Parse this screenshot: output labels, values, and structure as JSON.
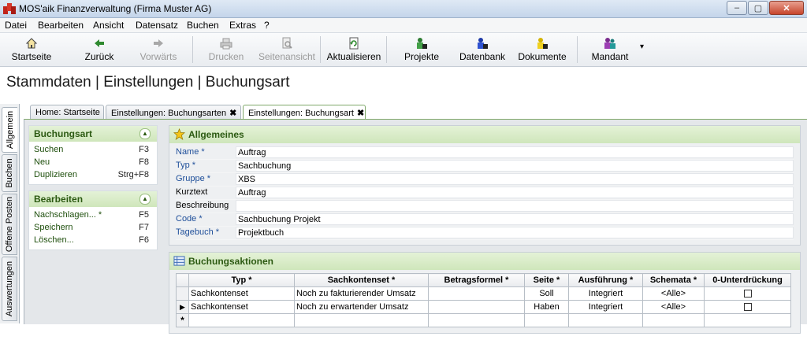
{
  "window": {
    "title": "MOS'aik Finanzverwaltung (Firma Muster AG)",
    "minimize": "–",
    "maximize": "▢",
    "close": "✕"
  },
  "menu": [
    "Datei",
    "Bearbeiten",
    "Ansicht",
    "Datensatz",
    "Buchen",
    "Extras",
    "?"
  ],
  "toolbar": {
    "home": "Startseite",
    "back": "Zurück",
    "forward": "Vorwärts",
    "print": "Drucken",
    "preview": "Seitenansicht",
    "refresh": "Aktualisieren",
    "projects": "Projekte",
    "database": "Datenbank",
    "documents": "Dokumente",
    "client": "Mandant",
    "more": "▾"
  },
  "page_title": "Stammdaten | Einstellungen | Buchungsart",
  "side_tabs": [
    "Allgemein",
    "Buchen",
    "Offene Posten",
    "Auswertungen"
  ],
  "doc_tabs": [
    {
      "label": "Home: Startseite",
      "close": ""
    },
    {
      "label": "Einstellungen: Buchungsarten",
      "close": "✖"
    },
    {
      "label": "Einstellungen: Buchungsart",
      "close": "✖"
    }
  ],
  "nav": {
    "buchungsart": {
      "title": "Buchungsart",
      "collapse": "▲",
      "items": [
        {
          "label": "Suchen",
          "key": "F3"
        },
        {
          "label": "Neu",
          "key": "F8"
        },
        {
          "label": "Duplizieren",
          "key": "Strg+F8"
        }
      ]
    },
    "bearbeiten": {
      "title": "Bearbeiten",
      "collapse": "▲",
      "items": [
        {
          "label": "Nachschlagen... *",
          "key": "F5"
        },
        {
          "label": "Speichern",
          "key": "F7"
        },
        {
          "label": "Löschen...",
          "key": "F6"
        }
      ]
    }
  },
  "general": {
    "title": "Allgemeines",
    "fields": [
      {
        "label": "Name *",
        "value": "Auftrag",
        "required": true
      },
      {
        "label": "Typ *",
        "value": "Sachbuchung",
        "required": true
      },
      {
        "label": "Gruppe *",
        "value": "XBS",
        "required": true
      },
      {
        "label": "Kurztext",
        "value": "Auftrag",
        "required": false
      },
      {
        "label": "Beschreibung",
        "value": "",
        "required": false
      },
      {
        "label": "Code *",
        "value": "Sachbuchung Projekt",
        "required": true
      },
      {
        "label": "Tagebuch *",
        "value": "Projektbuch",
        "required": true
      }
    ]
  },
  "actions": {
    "title": "Buchungsaktionen",
    "columns": [
      "Typ *",
      "Sachkontenset *",
      "Betragsformel *",
      "Seite *",
      "Ausführung *",
      "Schemata *",
      "0-Unterdrückung"
    ],
    "rows": [
      {
        "marker": "",
        "typ": "Sachkontenset",
        "set": "Noch zu fakturierender Umsatz",
        "formel": "",
        "seite": "Soll",
        "ausfuehrung": "Integriert",
        "schemata": "<Alle>"
      },
      {
        "marker": "▶",
        "typ": "Sachkontenset",
        "set": "Noch zu erwartender Umsatz",
        "formel": "",
        "seite": "Haben",
        "ausfuehrung": "Integriert",
        "schemata": "<Alle>"
      }
    ],
    "new_row_marker": "*"
  },
  "colors": {
    "accent_green": "#2c5a12",
    "required_blue": "#1f4f9a",
    "header_green": "#d6eac5"
  }
}
